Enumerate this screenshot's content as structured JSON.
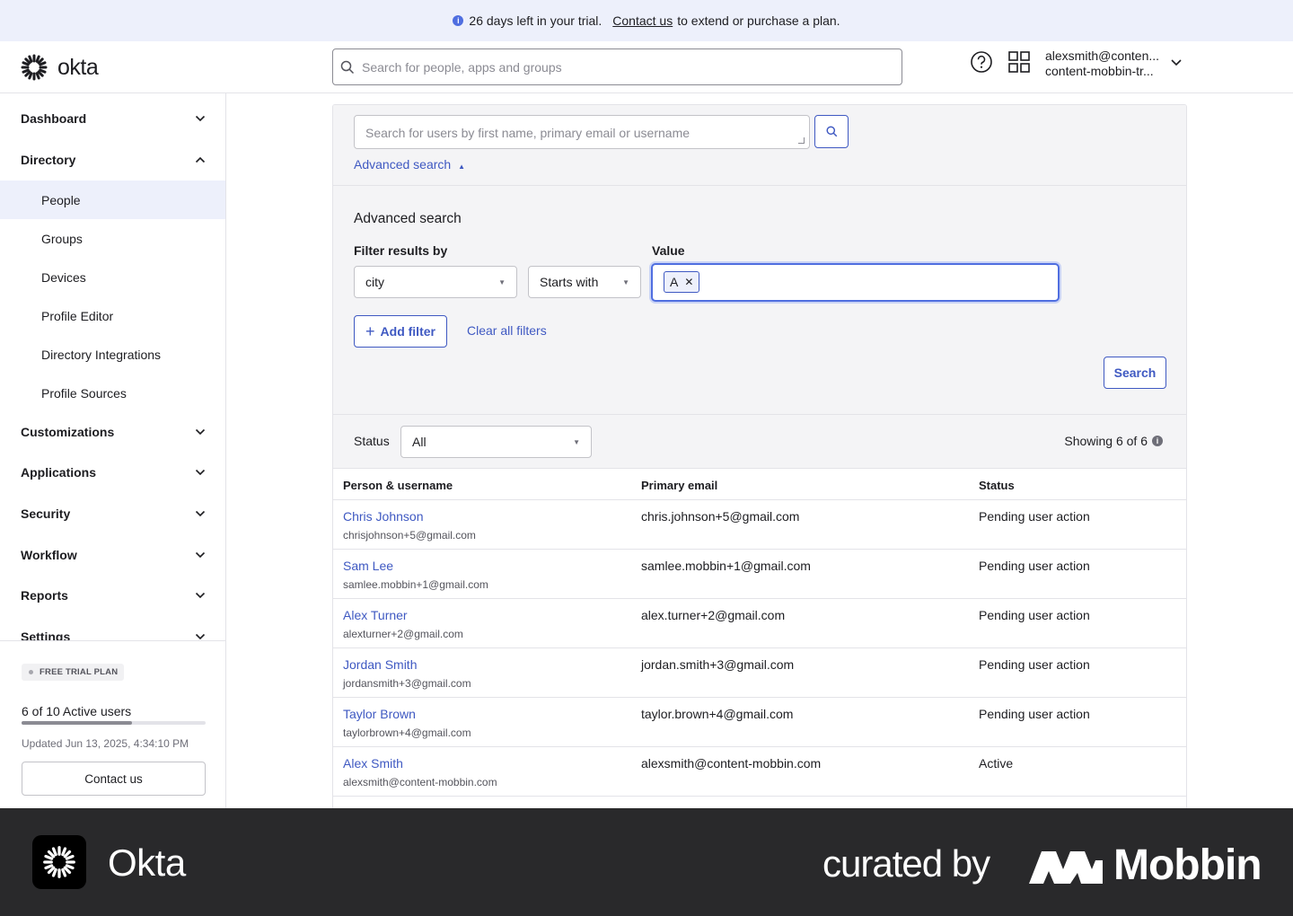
{
  "banner": {
    "message": "26 days left in your trial.",
    "link": "Contact us",
    "suffix": "to extend or purchase a plan."
  },
  "header": {
    "brand": "okta",
    "search_placeholder": "Search for people, apps and groups",
    "user_email": "alexsmith@conten...",
    "user_org": "content-mobbin-tr..."
  },
  "sidebar": {
    "items": [
      {
        "label": "Dashboard"
      },
      {
        "label": "Directory"
      },
      {
        "label": "Customizations"
      },
      {
        "label": "Applications"
      },
      {
        "label": "Security"
      },
      {
        "label": "Workflow"
      },
      {
        "label": "Reports"
      },
      {
        "label": "Settings"
      }
    ],
    "directory_children": [
      {
        "label": "People"
      },
      {
        "label": "Groups"
      },
      {
        "label": "Devices"
      },
      {
        "label": "Profile Editor"
      },
      {
        "label": "Directory Integrations"
      },
      {
        "label": "Profile Sources"
      }
    ],
    "trial": {
      "badge": "FREE TRIAL PLAN",
      "active_users": "6 of 10 Active users",
      "active_fraction": 0.6,
      "updated": "Updated Jun 13, 2025, 4:34:10 PM",
      "contact_label": "Contact us"
    }
  },
  "main": {
    "user_search_placeholder": "Search for users by first name, primary email or username",
    "advanced_toggle": "Advanced search",
    "advanced": {
      "title": "Advanced search",
      "filter_label": "Filter results by",
      "value_label": "Value",
      "filter_field": "city",
      "operator": "Starts with",
      "value_chip": "A",
      "add_filter": "Add filter",
      "clear_filters": "Clear all filters",
      "search_button": "Search"
    },
    "status_label": "Status",
    "status_value": "All",
    "showing": "Showing 6 of 6",
    "table": {
      "headers": [
        "Person & username",
        "Primary email",
        "Status"
      ],
      "rows": [
        {
          "name": "Chris Johnson",
          "username": "chrisjohnson+5@gmail.com",
          "email": "chris.johnson+5@gmail.com",
          "status": "Pending user action"
        },
        {
          "name": "Sam Lee",
          "username": "samlee.mobbin+1@gmail.com",
          "email": "samlee.mobbin+1@gmail.com",
          "status": "Pending user action"
        },
        {
          "name": "Alex Turner",
          "username": "alexturner+2@gmail.com",
          "email": "alex.turner+2@gmail.com",
          "status": "Pending user action"
        },
        {
          "name": "Jordan Smith",
          "username": "jordansmith+3@gmail.com",
          "email": "jordan.smith+3@gmail.com",
          "status": "Pending user action"
        },
        {
          "name": "Taylor Brown",
          "username": "taylorbrown+4@gmail.com",
          "email": "taylor.brown+4@gmail.com",
          "status": "Pending user action"
        },
        {
          "name": "Alex Smith",
          "username": "alexsmith@content-mobbin.com",
          "email": "alexsmith@content-mobbin.com",
          "status": "Active"
        }
      ]
    }
  },
  "footer": {
    "app_name": "Okta",
    "curated": "curated by",
    "brand": "Mobbin"
  },
  "colors": {
    "accent": "#3f59c2",
    "banner_bg": "#edf0fb",
    "footer_bg": "#29292b"
  }
}
